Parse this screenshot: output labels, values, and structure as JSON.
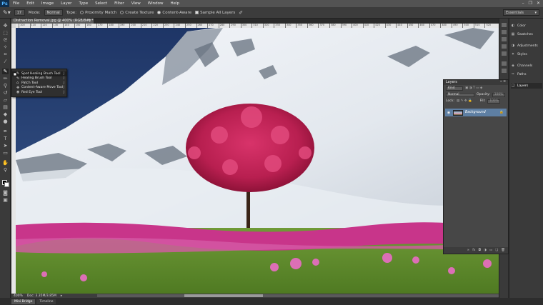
{
  "app": {
    "logo": "Ps"
  },
  "menu": [
    "File",
    "Edit",
    "Image",
    "Layer",
    "Type",
    "Select",
    "Filter",
    "View",
    "Window",
    "Help"
  ],
  "window_controls": [
    "–",
    "❐",
    "✕"
  ],
  "options": {
    "brush_size": "17",
    "mode_label": "Mode:",
    "mode_value": "Normal",
    "type_label": "Type:",
    "type_options": [
      "Proximity Match",
      "Create Texture",
      "Content-Aware"
    ],
    "type_selected_index": 2,
    "sample_all_layers": "Sample All Layers",
    "workspace": "Essentials"
  },
  "document": {
    "tab_title": "Distraction Removal.jpg @ 400% (RGB/8#) *",
    "close": "×",
    "zoom": "400%",
    "doc_info": "Doc: 3.35M/3.85M"
  },
  "ruler_ticks": [
    "100",
    "110",
    "120",
    "130",
    "140",
    "150",
    "160",
    "170",
    "180",
    "190",
    "200",
    "210",
    "220",
    "230",
    "240",
    "250",
    "260",
    "270",
    "280",
    "290",
    "300",
    "310",
    "320",
    "330",
    "340",
    "350",
    "360",
    "370",
    "380",
    "390",
    "400",
    "410",
    "420",
    "430",
    "440",
    "450",
    "460",
    "470",
    "480",
    "490",
    "500",
    "510",
    "520"
  ],
  "tool_flyout": {
    "items": [
      {
        "label": "Spot Healing Brush Tool",
        "key": "J",
        "active": true,
        "icon": "spot-healing-brush-icon",
        "glyph": "✎"
      },
      {
        "label": "Healing Brush Tool",
        "key": "J",
        "active": false,
        "icon": "healing-brush-icon",
        "glyph": "✎"
      },
      {
        "label": "Patch Tool",
        "key": "J",
        "active": false,
        "icon": "patch-icon",
        "glyph": "⌂"
      },
      {
        "label": "Content-Aware Move Tool",
        "key": "J",
        "active": false,
        "icon": "content-aware-move-icon",
        "glyph": "✥"
      },
      {
        "label": "Red Eye Tool",
        "key": "J",
        "active": false,
        "icon": "red-eye-icon",
        "glyph": "◉"
      }
    ]
  },
  "right_dock": [
    {
      "label": "Color",
      "icon": "color-icon",
      "glyph": "◐"
    },
    {
      "label": "Swatches",
      "icon": "swatches-icon",
      "glyph": "▦"
    },
    {
      "label": "Adjustments",
      "icon": "adjustments-icon",
      "glyph": "◑"
    },
    {
      "label": "Styles",
      "icon": "styles-icon",
      "glyph": "✦"
    },
    {
      "label": "Channels",
      "icon": "channels-icon",
      "glyph": "◈"
    },
    {
      "label": "Paths",
      "icon": "paths-icon",
      "glyph": "✑"
    },
    {
      "label": "Layers",
      "icon": "layers-icon",
      "glyph": "❑",
      "active": true
    }
  ],
  "layers_panel": {
    "title": "Layers",
    "kind": "Kind",
    "blend_mode": "Normal",
    "opacity_label": "Opacity:",
    "opacity_value": "100%",
    "lock_label": "Lock:",
    "fill_label": "Fill:",
    "fill_value": "100%",
    "layer_name": "Background"
  },
  "bottom_tabs": [
    "Mini Bridge",
    "Timeline"
  ]
}
